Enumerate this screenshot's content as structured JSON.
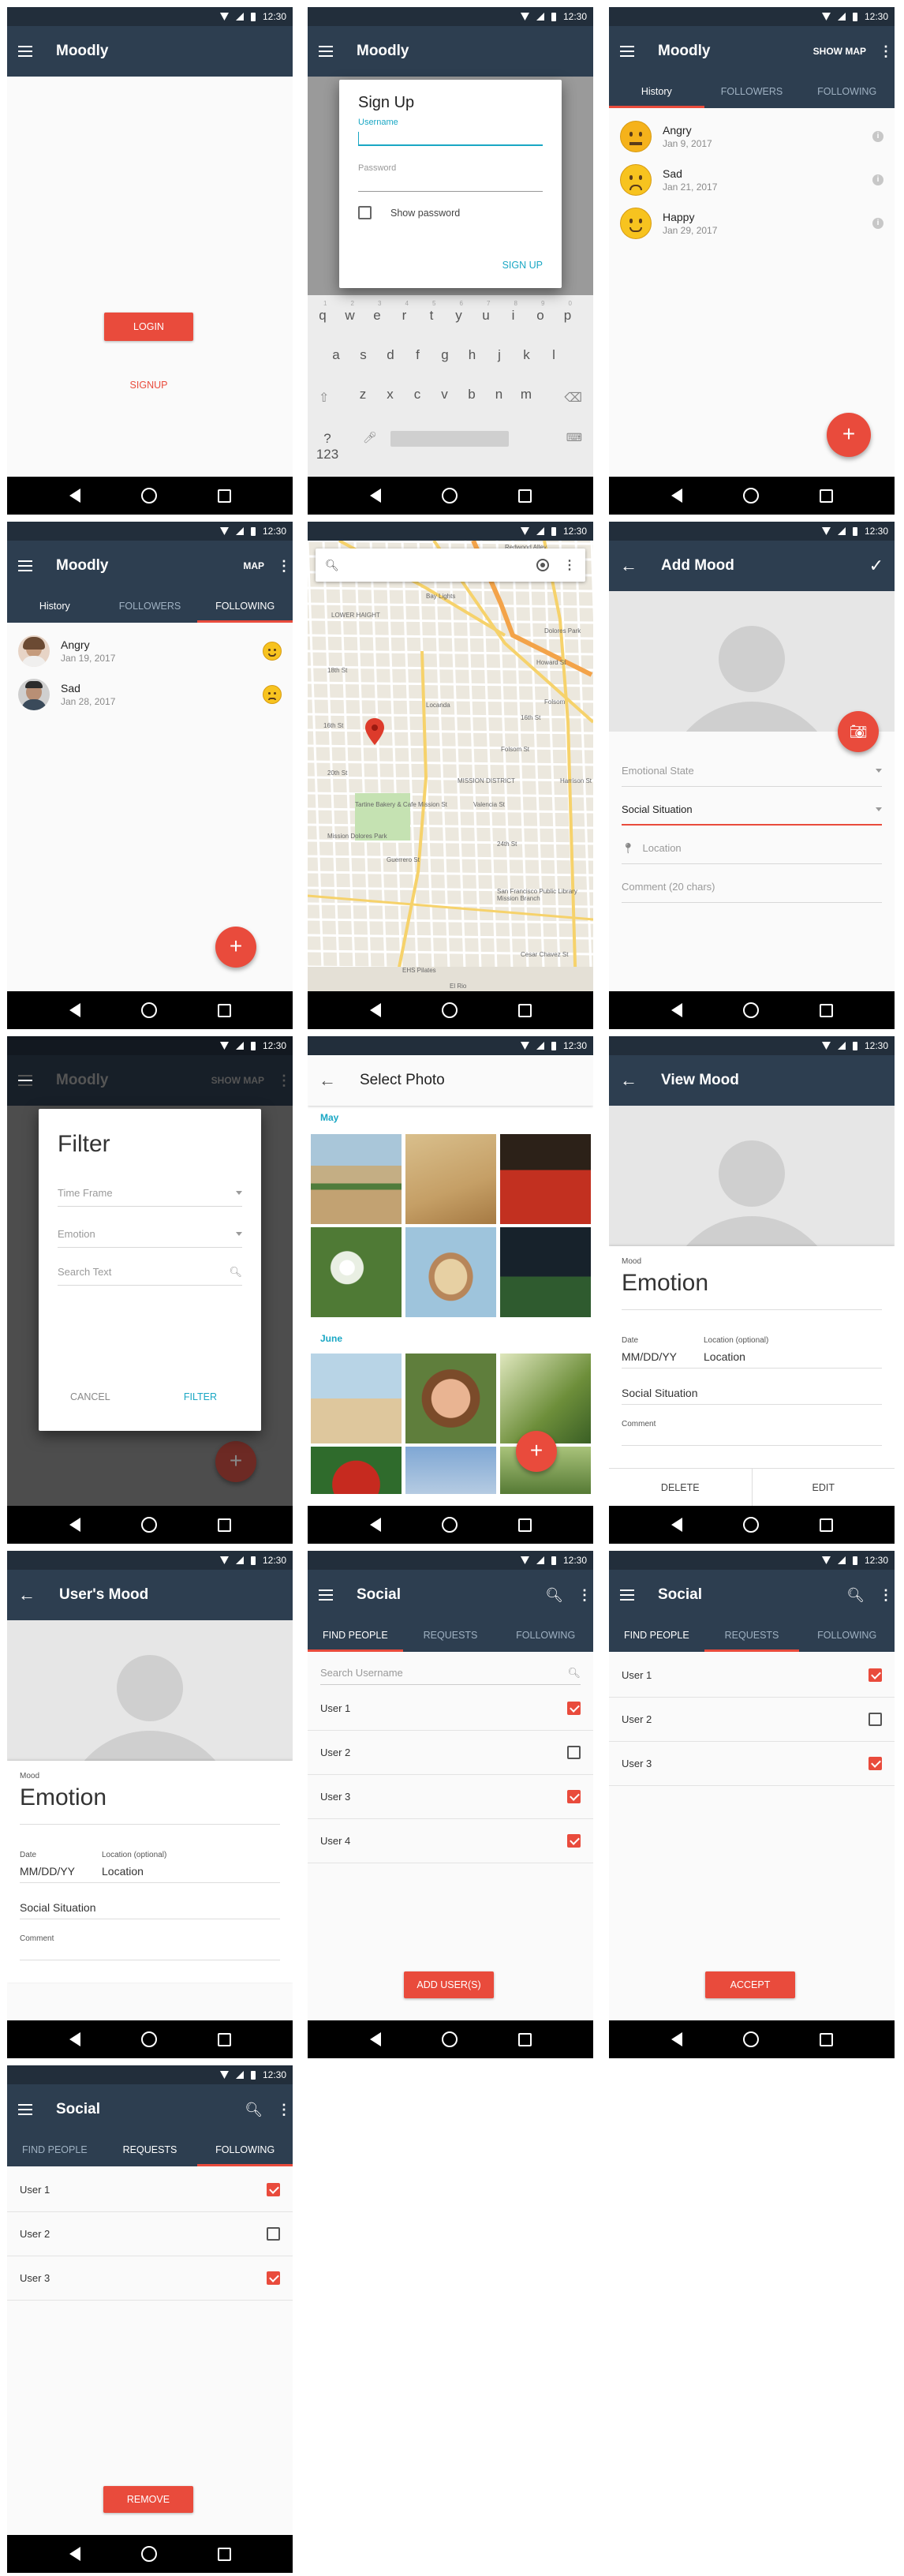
{
  "status": {
    "time": "12:30"
  },
  "s1": {
    "title": "Moodly",
    "login": "LOGIN",
    "signup": "SIGNUP"
  },
  "s2": {
    "title": "Moodly",
    "dialog_title": "Sign Up",
    "username_label": "Username",
    "password_label": "Password",
    "show_password": "Show password",
    "signup_btn": "SIGN UP",
    "keyboard": {
      "numbers": [
        "1",
        "2",
        "3",
        "4",
        "5",
        "6",
        "7",
        "8",
        "9",
        "0"
      ],
      "row1": [
        "q",
        "w",
        "e",
        "r",
        "t",
        "y",
        "u",
        "i",
        "o",
        "p"
      ],
      "row2": [
        "a",
        "s",
        "d",
        "f",
        "g",
        "h",
        "j",
        "k",
        "l"
      ],
      "row3": [
        "z",
        "x",
        "c",
        "v",
        "b",
        "n",
        "m"
      ],
      "sym": "?123"
    }
  },
  "s3": {
    "title": "Moodly",
    "action": "SHOW MAP",
    "tabs": [
      "History",
      "FOLLOWERS",
      "FOLLOWING"
    ],
    "items": [
      {
        "name": "Angry",
        "date": "Jan 9, 2017",
        "mood": "angry"
      },
      {
        "name": "Sad",
        "date": "Jan 21, 2017",
        "mood": "sad"
      },
      {
        "name": "Happy",
        "date": "Jan 29, 2017",
        "mood": "happy"
      }
    ],
    "fab": "+"
  },
  "s4": {
    "title": "Moodly",
    "action": "MAP",
    "tabs": [
      "History",
      "FOLLOWERS",
      "FOLLOWING"
    ],
    "items": [
      {
        "name": "Angry",
        "date": "Jan 19, 2017",
        "mood": "happy"
      },
      {
        "name": "Sad",
        "date": "Jan 28, 2017",
        "mood": "sad"
      }
    ],
    "fab": "+"
  },
  "s5": {
    "labels": [
      "Redwood Alley",
      "Civic Center",
      "Bay Lights",
      "Dolores Park",
      "Locanda",
      "Tartine Bakery & Cafe",
      "Mission Dolores Park",
      "San Francisco Public Library Mission Branch",
      "EHS Pilates",
      "Cesar Chavez St",
      "Valencia St",
      "Folsom St",
      "Guerrero St",
      "16th St",
      "18th St",
      "20th St",
      "24th St",
      "Mission St",
      "Howard St",
      "El Rio",
      "LOWER HAIGHT",
      "MISSION DISTRICT",
      "16th St",
      "Harrison St",
      "Folsom"
    ]
  },
  "s6": {
    "title": "Add Mood",
    "emotional_state": "Emotional State",
    "social_situation": "Social Situation",
    "location": "Location",
    "comment": "Comment (20 chars)"
  },
  "s7": {
    "bg_title": "Moodly",
    "bg_action": "SHOW MAP",
    "title": "Filter",
    "time_frame": "Time Frame",
    "emotion": "Emotion",
    "search": "Search Text",
    "cancel": "CANCEL",
    "filter": "FILTER"
  },
  "s8": {
    "title": "Select Photo",
    "month1": "May",
    "month2": "June",
    "fab": "+"
  },
  "s9": {
    "title": "View Mood",
    "mood_label": "Mood",
    "mood": "Emotion",
    "date_label": "Date",
    "date": "MM/DD/YY",
    "loc_label": "Location (optional)",
    "loc": "Location",
    "social": "Social Situation",
    "comment_label": "Comment",
    "delete": "DELETE",
    "edit": "EDIT"
  },
  "s10": {
    "title": "User's Mood",
    "mood_label": "Mood",
    "mood": "Emotion",
    "date_label": "Date",
    "date": "MM/DD/YY",
    "loc_label": "Location (optional)",
    "loc": "Location",
    "social": "Social Situation",
    "comment_label": "Comment"
  },
  "s11": {
    "title": "Social",
    "tabs": [
      "FIND PEOPLE",
      "REQUESTS",
      "FOLLOWING"
    ],
    "search": "Search Username",
    "users": [
      {
        "name": "User 1",
        "checked": true
      },
      {
        "name": "User 2",
        "checked": false
      },
      {
        "name": "User 3",
        "checked": true
      },
      {
        "name": "User 4",
        "checked": true
      }
    ],
    "button": "ADD USER(S)"
  },
  "s12": {
    "title": "Social",
    "tabs": [
      "FIND PEOPLE",
      "REQUESTS",
      "FOLLOWING"
    ],
    "users": [
      {
        "name": "User 1",
        "checked": true
      },
      {
        "name": "User 2",
        "checked": false
      },
      {
        "name": "User 3",
        "checked": true
      }
    ],
    "button": "ACCEPT"
  },
  "s13": {
    "title": "Social",
    "tabs": [
      "FIND PEOPLE",
      "REQUESTS",
      "FOLLOWING"
    ],
    "users": [
      {
        "name": "User 1",
        "checked": true
      },
      {
        "name": "User 2",
        "checked": false
      },
      {
        "name": "User 3",
        "checked": true
      }
    ],
    "button": "REMOVE"
  }
}
